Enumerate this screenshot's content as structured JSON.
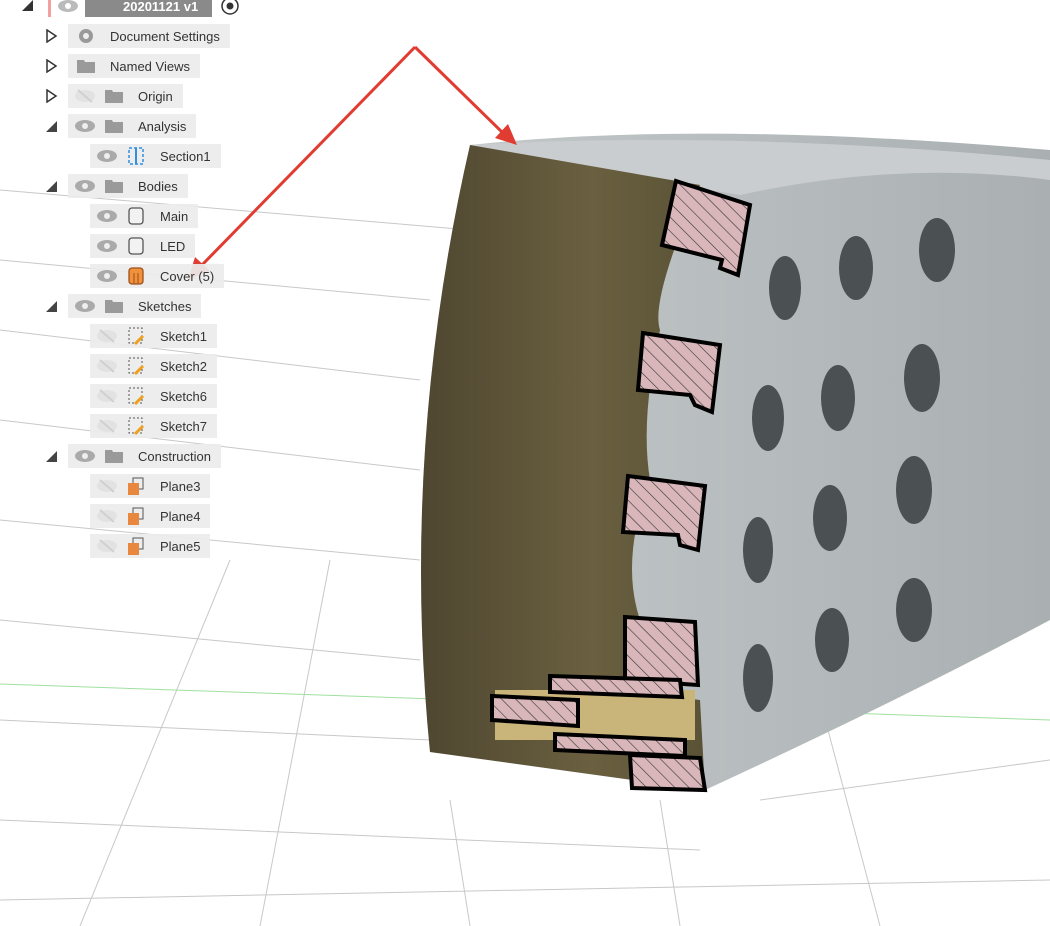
{
  "browser": {
    "root": {
      "label": "20201121 v1"
    },
    "items": [
      {
        "label": "Document Settings",
        "level": 1,
        "expander": "collapsed",
        "icon": "gear-icon",
        "eye": "none"
      },
      {
        "label": "Named Views",
        "level": 1,
        "expander": "collapsed",
        "icon": "folder-icon",
        "eye": "none"
      },
      {
        "label": "Origin",
        "level": 1,
        "expander": "collapsed",
        "icon": "folder-icon",
        "eye": "hidden"
      },
      {
        "label": "Analysis",
        "level": 1,
        "expander": "expanded",
        "icon": "folder-icon",
        "eye": "visible"
      },
      {
        "label": "Section1",
        "level": 2,
        "icon": "section-icon",
        "eye": "visible"
      },
      {
        "label": "Bodies",
        "level": 1,
        "expander": "expanded",
        "icon": "folder-icon",
        "eye": "visible"
      },
      {
        "label": "Main",
        "level": 2,
        "icon": "body-icon",
        "eye": "visible"
      },
      {
        "label": "LED",
        "level": 2,
        "icon": "body-icon",
        "eye": "visible"
      },
      {
        "label": "Cover (5)",
        "level": 2,
        "icon": "body-orange-icon",
        "eye": "visible"
      },
      {
        "label": "Sketches",
        "level": 1,
        "expander": "expanded",
        "icon": "folder-icon",
        "eye": "visible"
      },
      {
        "label": "Sketch1",
        "level": 2,
        "icon": "sketch-icon",
        "eye": "hidden"
      },
      {
        "label": "Sketch2",
        "level": 2,
        "icon": "sketch-icon",
        "eye": "hidden"
      },
      {
        "label": "Sketch6",
        "level": 2,
        "icon": "sketch-icon",
        "eye": "hidden"
      },
      {
        "label": "Sketch7",
        "level": 2,
        "icon": "sketch-icon",
        "eye": "hidden"
      },
      {
        "label": "Construction",
        "level": 1,
        "expander": "expanded",
        "icon": "folder-icon",
        "eye": "visible"
      },
      {
        "label": "Plane3",
        "level": 2,
        "icon": "plane-icon",
        "eye": "hidden"
      },
      {
        "label": "Plane4",
        "level": 2,
        "icon": "plane-icon",
        "eye": "hidden"
      },
      {
        "label": "Plane5",
        "level": 2,
        "icon": "plane-icon",
        "eye": "hidden"
      }
    ]
  },
  "colors": {
    "annotation": "#e03c31",
    "section_hatch": "#d8b4b8",
    "cut_face": "#5f5638",
    "body": "#b9bfc0"
  }
}
